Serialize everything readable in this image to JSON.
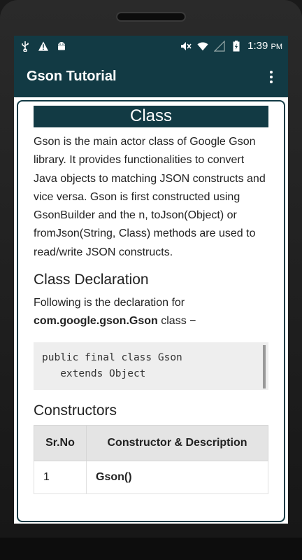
{
  "status_bar": {
    "icons_left": [
      "usb-icon",
      "warning-icon",
      "android-icon"
    ],
    "icons_right": [
      "mute-icon",
      "wifi-icon",
      "signal-icon",
      "battery-icon"
    ],
    "time": "1:39",
    "ampm": "PM"
  },
  "app_bar": {
    "title": "Gson Tutorial"
  },
  "content": {
    "heading": "Class",
    "intro": "Gson is the main actor class of Google Gson library. It provides functionalities to convert Java objects to matching JSON constructs and vice versa. Gson is first constructed using GsonBuilder and the n, toJson(Object) or fromJson(String, Class) methods are used to read/write JSON constructs.",
    "declaration_heading": "Class Declaration",
    "declaration_text_prefix": "Following is the declaration for",
    "declaration_class": "com.google.gson.Gson",
    "declaration_text_suffix": "class −",
    "code_line1": "public final class Gson",
    "code_line2": "   extends Object",
    "constructors_heading": "Constructors",
    "table": {
      "headers": [
        "Sr.No",
        "Constructor & Description"
      ],
      "rows": [
        {
          "num": "1",
          "desc": "Gson()"
        }
      ]
    }
  }
}
